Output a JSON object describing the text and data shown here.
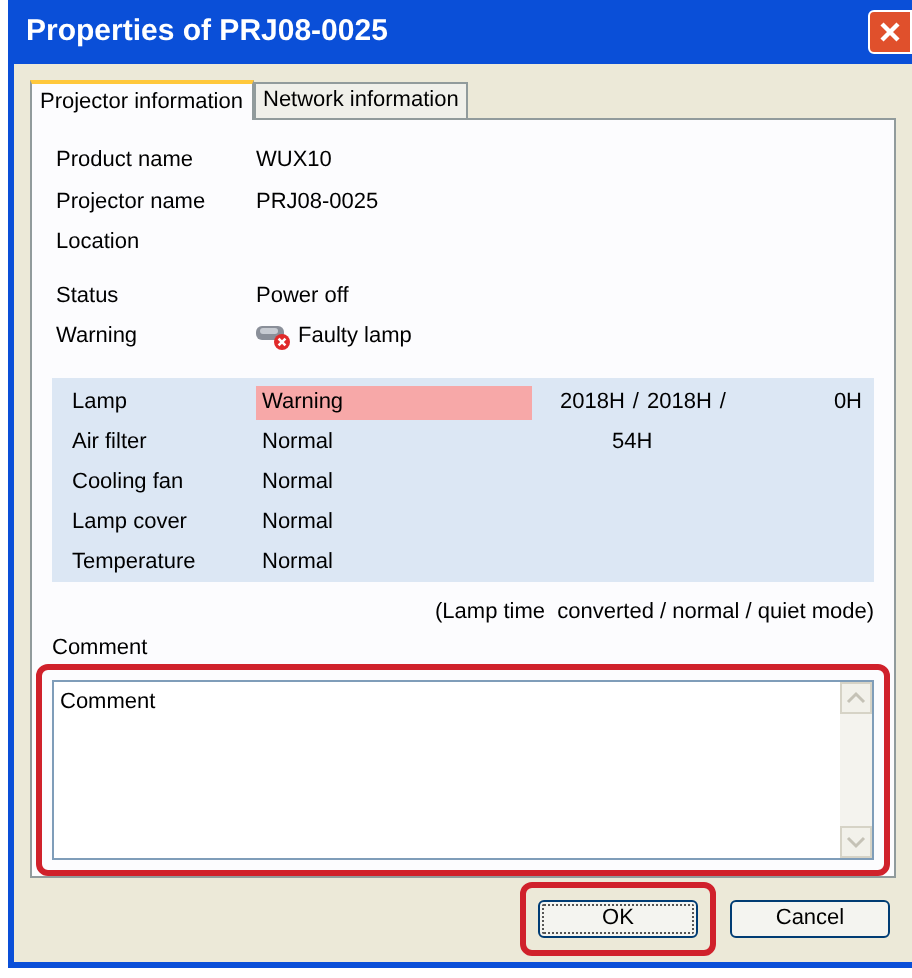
{
  "window": {
    "title": "Properties of PRJ08-0025"
  },
  "tabs": [
    {
      "label": "Projector information",
      "selected": true
    },
    {
      "label": "Network information",
      "selected": false
    }
  ],
  "info": [
    {
      "label": "Product name",
      "value": "WUX10"
    },
    {
      "label": "Projector name",
      "value": "PRJ08-0025"
    },
    {
      "label": "Location"
    }
  ],
  "state": [
    {
      "label": "Status",
      "value": "Power off"
    },
    {
      "label": "Warning",
      "value": "Faulty lamp",
      "kind": "alert"
    }
  ],
  "components": [
    {
      "name": "Lamp",
      "status": "Warning",
      "warning": true,
      "hours": [
        "2018H",
        "/",
        "2018H",
        "/",
        "0H"
      ]
    },
    {
      "name": "Air filter",
      "status": "Normal",
      "warning": false,
      "hours": [
        "54H"
      ]
    },
    {
      "name": "Cooling fan",
      "status": "Normal",
      "warning": false
    },
    {
      "name": "Lamp cover",
      "status": "Normal",
      "warning": false
    },
    {
      "name": "Temperature",
      "status": "Normal",
      "warning": false
    }
  ],
  "lamp_time_note": "(Lamp time  converted / normal / quiet mode)",
  "comment": {
    "label": "Comment",
    "value": "Comment"
  },
  "buttons": [
    {
      "label": "OK",
      "highlighted": true,
      "default": true
    },
    {
      "label": "Cancel",
      "highlighted": false,
      "default": false
    }
  ],
  "comment_highlighted": true
}
